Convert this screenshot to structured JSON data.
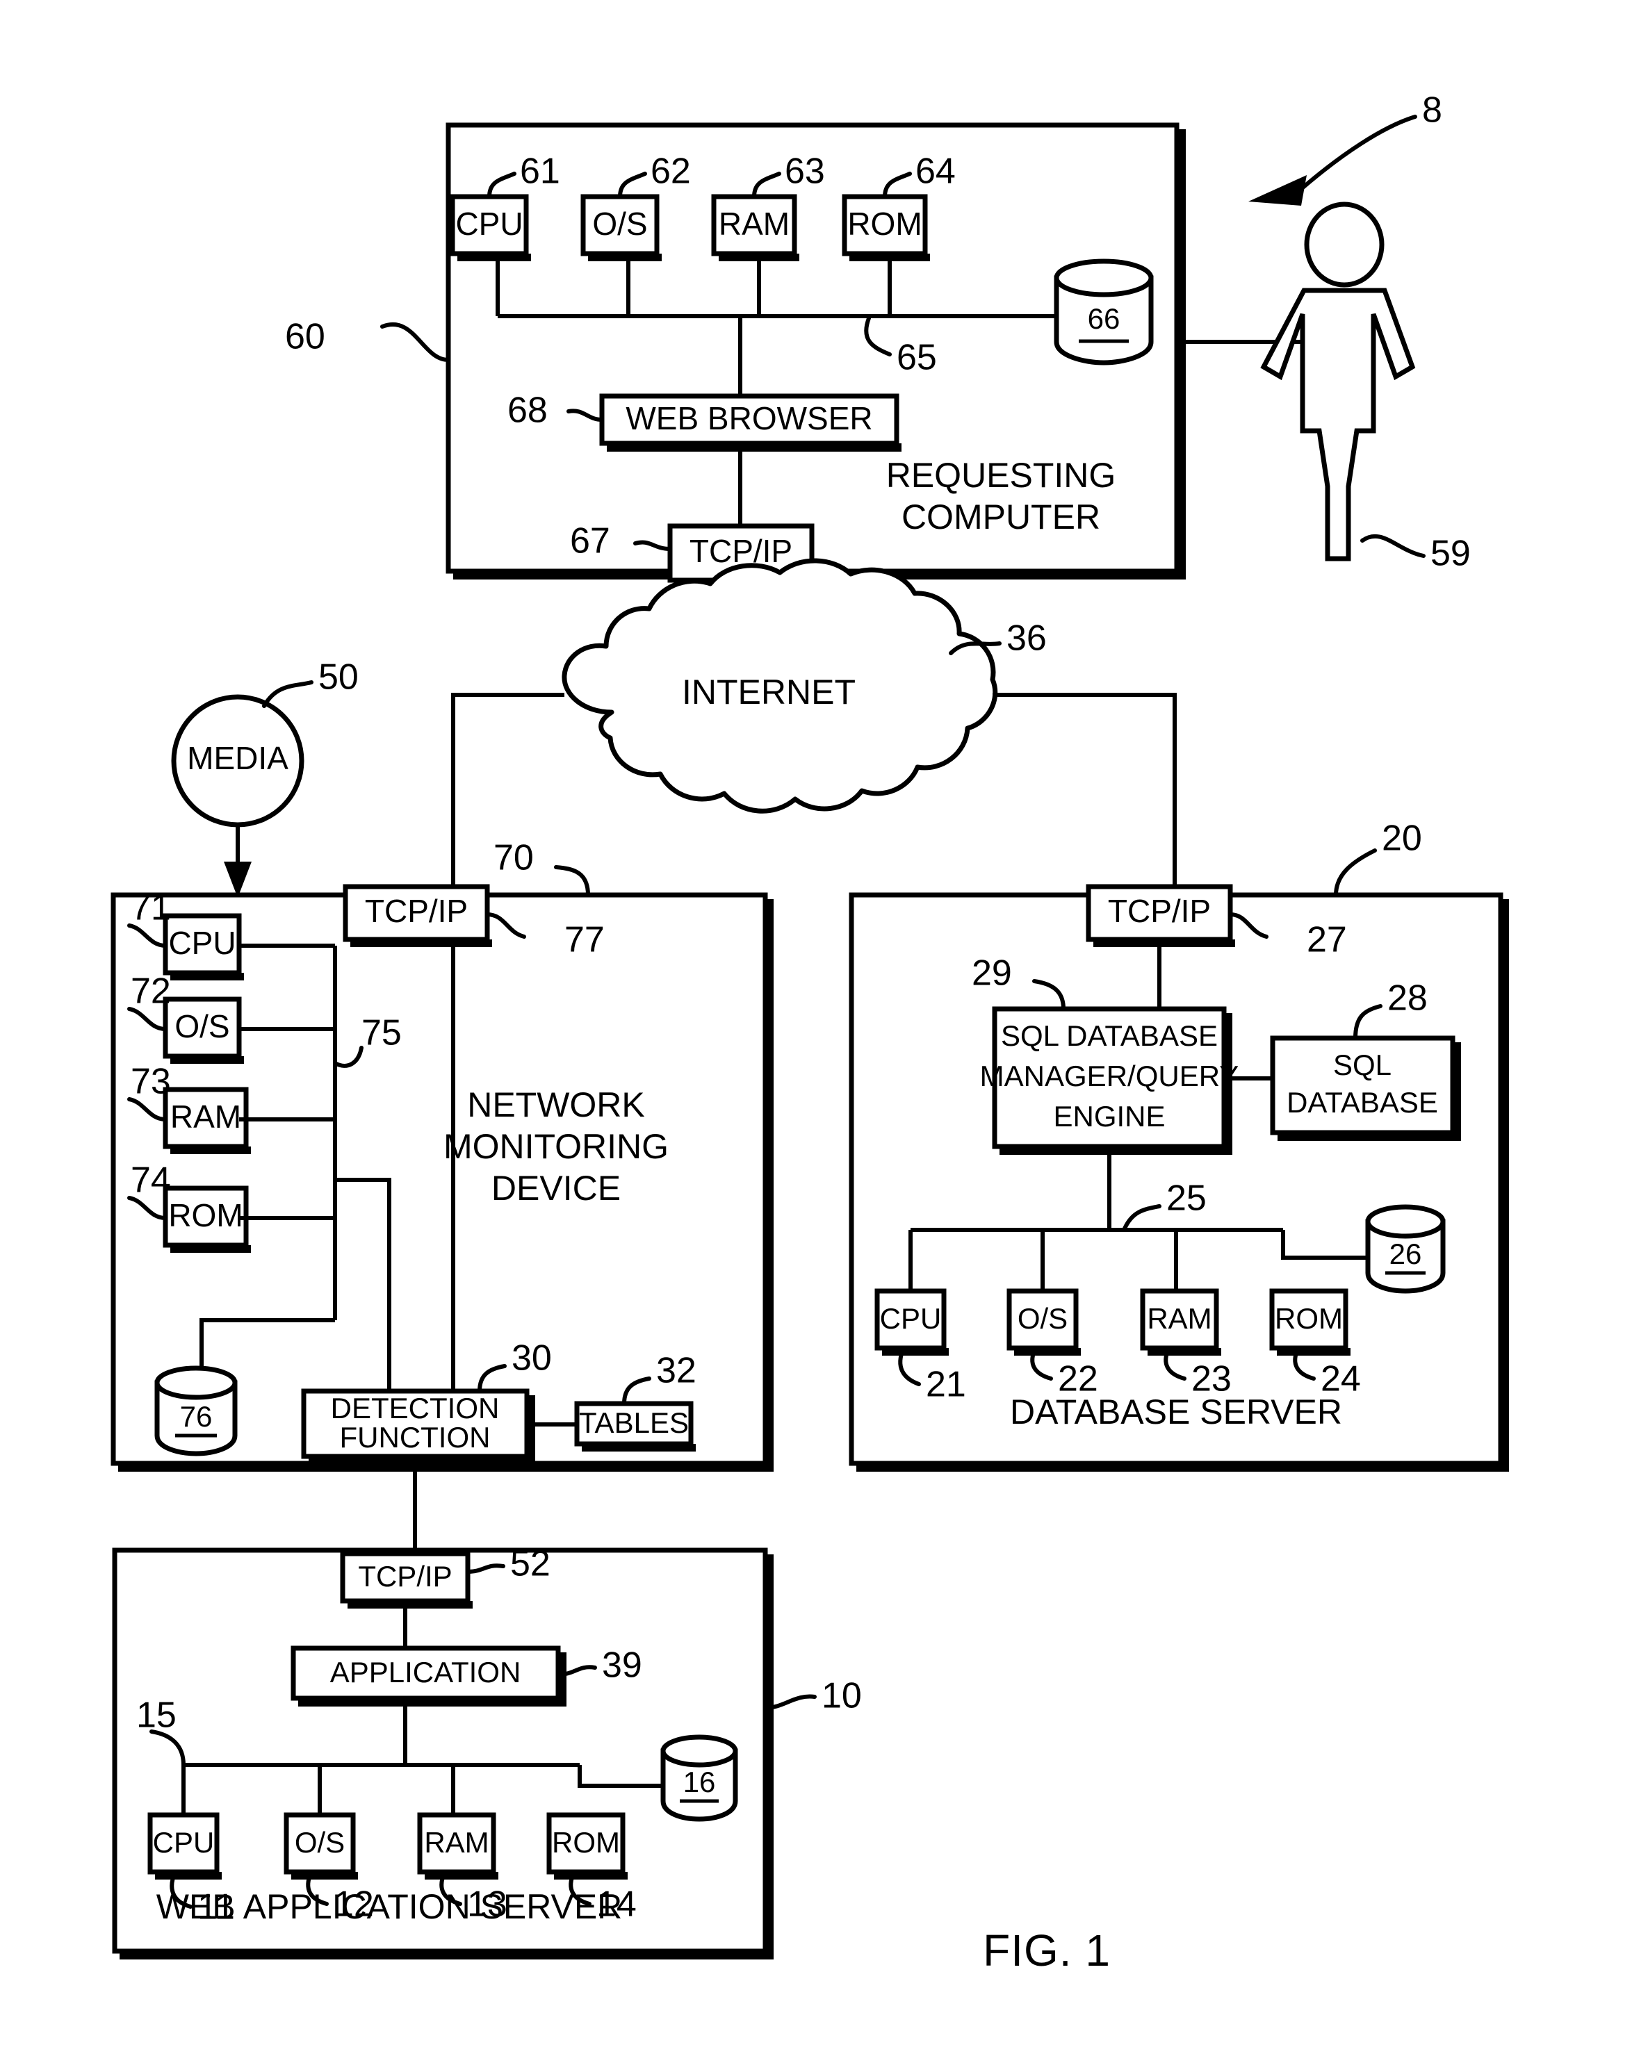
{
  "figure": {
    "caption": "FIG. 1",
    "system_ref": "8"
  },
  "requesting_computer": {
    "title_line1": "REQUESTING",
    "title_line2": "COMPUTER",
    "ref": "60",
    "components": [
      {
        "label": "CPU",
        "ref": "61"
      },
      {
        "label": "O/S",
        "ref": "62"
      },
      {
        "label": "RAM",
        "ref": "63"
      },
      {
        "label": "ROM",
        "ref": "64"
      }
    ],
    "bus_ref": "65",
    "storage_ref": "66",
    "browser": {
      "label": "WEB BROWSER",
      "ref": "68"
    },
    "tcpip": {
      "label": "TCP/IP",
      "ref": "67"
    }
  },
  "user": {
    "label_ref": "59"
  },
  "network": {
    "cloud_label": "INTERNET",
    "cloud_ref": "36"
  },
  "media": {
    "label": "MEDIA",
    "ref": "50"
  },
  "network_monitoring_device": {
    "title_line1": "NETWORK",
    "title_line2": "MONITORING",
    "title_line3": "DEVICE",
    "ref": "70",
    "tcpip": {
      "label": "TCP/IP",
      "ref": "77"
    },
    "components": [
      {
        "label": "CPU",
        "ref": "71"
      },
      {
        "label": "O/S",
        "ref": "72"
      },
      {
        "label": "RAM",
        "ref": "73"
      },
      {
        "label": "ROM",
        "ref": "74"
      }
    ],
    "bus_ref": "75",
    "storage_ref": "76",
    "detection_function": {
      "label_line1": "DETECTION",
      "label_line2": "FUNCTION",
      "ref": "30"
    },
    "tables": {
      "label": "TABLES",
      "ref": "32"
    }
  },
  "database_server": {
    "title": "DATABASE SERVER",
    "ref": "20",
    "tcpip": {
      "label": "TCP/IP",
      "ref": "27"
    },
    "manager": {
      "label_line1": "SQL DATABASE",
      "label_line2": "MANAGER/QUERY",
      "label_line3": "ENGINE",
      "ref": "29"
    },
    "sql_database": {
      "label_line1": "SQL",
      "label_line2": "DATABASE",
      "ref": "28"
    },
    "components": [
      {
        "label": "CPU",
        "ref": "21"
      },
      {
        "label": "O/S",
        "ref": "22"
      },
      {
        "label": "RAM",
        "ref": "23"
      },
      {
        "label": "ROM",
        "ref": "24"
      }
    ],
    "bus_ref": "25",
    "storage_ref": "26"
  },
  "web_application_server": {
    "title": "WEB APPLICATION SERVER",
    "ref": "10",
    "tcpip": {
      "label": "TCP/IP",
      "ref": "52"
    },
    "application": {
      "label": "APPLICATION",
      "ref": "39"
    },
    "components": [
      {
        "label": "CPU",
        "ref": "11"
      },
      {
        "label": "O/S",
        "ref": "12"
      },
      {
        "label": "RAM",
        "ref": "13"
      },
      {
        "label": "ROM",
        "ref": "14"
      }
    ],
    "bus_ref": "15",
    "storage_ref": "16"
  },
  "colors": {
    "ink": "#000000",
    "paper": "#ffffff"
  }
}
